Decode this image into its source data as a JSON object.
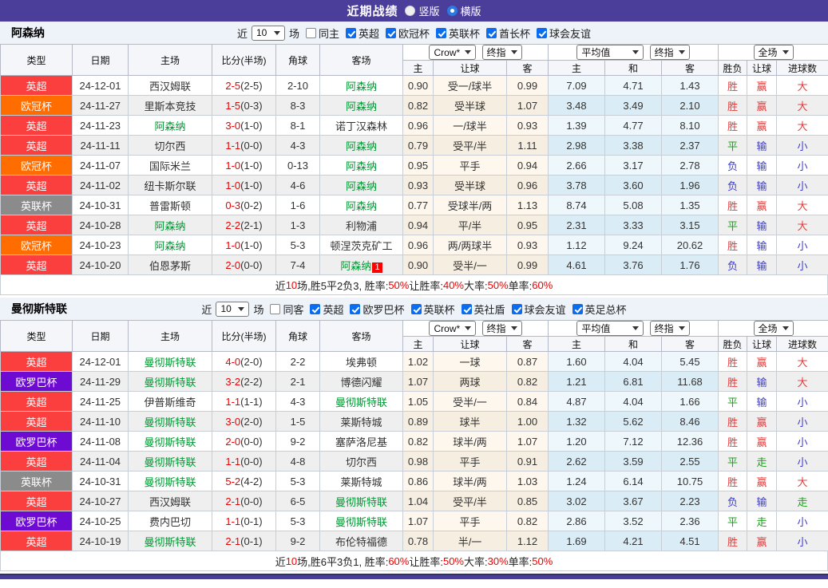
{
  "topbar": {
    "title": "近期战绩",
    "vertical_label": "竖版",
    "horizontal_label": "横版"
  },
  "columns": {
    "type": "类型",
    "date": "日期",
    "home": "主场",
    "score": "比分(半场)",
    "corner": "角球",
    "away": "客场",
    "odds_home": "主",
    "odds_handicap": "让球",
    "odds_away": "客",
    "avg_home": "主",
    "avg_draw": "和",
    "avg_away": "客",
    "result_outcome": "胜负",
    "result_handicap": "让球",
    "result_goals": "进球数",
    "select_company": "Crow*",
    "select_stage1": "终指",
    "select_average": "平均值",
    "select_stage2": "终指",
    "select_scope": "全场"
  },
  "filters_common": {
    "near": "近",
    "count": "10",
    "games": "场"
  },
  "league_colors": {
    "英超": "#fb3e3e",
    "欧冠杯": "#ff6c00",
    "英联杯": "#8b8b8b",
    "欧罗巴杯": "#6d0bd3"
  },
  "result_colors": {
    "r": "#e13c3c",
    "g": "#1ca01c",
    "b": "#3c3cc8"
  },
  "sections": [
    {
      "team": "阿森纳",
      "same_side": "同主",
      "leagues": [
        "英超",
        "欧冠杯",
        "英联杯",
        "酋长杯",
        "球会友谊"
      ],
      "rows": [
        {
          "league": "英超",
          "date": "24-12-01",
          "home": "西汉姆联",
          "home_focus": false,
          "score": "2-5",
          "half": "(2-5)",
          "corner": "2-10",
          "away": "阿森纳",
          "away_focus": true,
          "away_card": "",
          "odds": [
            "0.90",
            "受一/球半",
            "0.99"
          ],
          "avg": [
            "7.09",
            "4.71",
            "1.43"
          ],
          "results": [
            [
              "胜",
              "r"
            ],
            [
              "赢",
              "r"
            ],
            [
              "大",
              "r"
            ]
          ]
        },
        {
          "league": "欧冠杯",
          "date": "24-11-27",
          "home": "里斯本竞技",
          "home_focus": false,
          "score": "1-5",
          "half": "(0-3)",
          "corner": "8-3",
          "away": "阿森纳",
          "away_focus": true,
          "away_card": "",
          "odds": [
            "0.82",
            "受半球",
            "1.07"
          ],
          "avg": [
            "3.48",
            "3.49",
            "2.10"
          ],
          "results": [
            [
              "胜",
              "r"
            ],
            [
              "赢",
              "r"
            ],
            [
              "大",
              "r"
            ]
          ]
        },
        {
          "league": "英超",
          "date": "24-11-23",
          "home": "阿森纳",
          "home_focus": true,
          "score": "3-0",
          "half": "(1-0)",
          "corner": "8-1",
          "away": "诺丁汉森林",
          "away_focus": false,
          "away_card": "",
          "odds": [
            "0.96",
            "一/球半",
            "0.93"
          ],
          "avg": [
            "1.39",
            "4.77",
            "8.10"
          ],
          "results": [
            [
              "胜",
              "r"
            ],
            [
              "赢",
              "r"
            ],
            [
              "大",
              "r"
            ]
          ]
        },
        {
          "league": "英超",
          "date": "24-11-11",
          "home": "切尔西",
          "home_focus": false,
          "score": "1-1",
          "half": "(0-0)",
          "corner": "4-3",
          "away": "阿森纳",
          "away_focus": true,
          "away_card": "",
          "odds": [
            "0.79",
            "受平/半",
            "1.11"
          ],
          "avg": [
            "2.98",
            "3.38",
            "2.37"
          ],
          "results": [
            [
              "平",
              "g"
            ],
            [
              "输",
              "b"
            ],
            [
              "小",
              "b"
            ]
          ]
        },
        {
          "league": "欧冠杯",
          "date": "24-11-07",
          "home": "国际米兰",
          "home_focus": false,
          "score": "1-0",
          "half": "(1-0)",
          "corner": "0-13",
          "away": "阿森纳",
          "away_focus": true,
          "away_card": "",
          "odds": [
            "0.95",
            "平手",
            "0.94"
          ],
          "avg": [
            "2.66",
            "3.17",
            "2.78"
          ],
          "results": [
            [
              "负",
              "b"
            ],
            [
              "输",
              "b"
            ],
            [
              "小",
              "b"
            ]
          ]
        },
        {
          "league": "英超",
          "date": "24-11-02",
          "home": "纽卡斯尔联",
          "home_focus": false,
          "score": "1-0",
          "half": "(1-0)",
          "corner": "4-6",
          "away": "阿森纳",
          "away_focus": true,
          "away_card": "",
          "odds": [
            "0.93",
            "受半球",
            "0.96"
          ],
          "avg": [
            "3.78",
            "3.60",
            "1.96"
          ],
          "results": [
            [
              "负",
              "b"
            ],
            [
              "输",
              "b"
            ],
            [
              "小",
              "b"
            ]
          ]
        },
        {
          "league": "英联杯",
          "date": "24-10-31",
          "home": "普雷斯顿",
          "home_focus": false,
          "score": "0-3",
          "half": "(0-2)",
          "corner": "1-6",
          "away": "阿森纳",
          "away_focus": true,
          "away_card": "",
          "odds": [
            "0.77",
            "受球半/两",
            "1.13"
          ],
          "avg": [
            "8.74",
            "5.08",
            "1.35"
          ],
          "results": [
            [
              "胜",
              "r"
            ],
            [
              "赢",
              "r"
            ],
            [
              "大",
              "r"
            ]
          ]
        },
        {
          "league": "英超",
          "date": "24-10-28",
          "home": "阿森纳",
          "home_focus": true,
          "score": "2-2",
          "half": "(2-1)",
          "corner": "1-3",
          "away": "利物浦",
          "away_focus": false,
          "away_card": "",
          "odds": [
            "0.94",
            "平/半",
            "0.95"
          ],
          "avg": [
            "2.31",
            "3.33",
            "3.15"
          ],
          "results": [
            [
              "平",
              "g"
            ],
            [
              "输",
              "b"
            ],
            [
              "大",
              "r"
            ]
          ]
        },
        {
          "league": "欧冠杯",
          "date": "24-10-23",
          "home": "阿森纳",
          "home_focus": true,
          "score": "1-0",
          "half": "(1-0)",
          "corner": "5-3",
          "away": "顿涅茨克矿工",
          "away_focus": false,
          "away_card": "",
          "odds": [
            "0.96",
            "两/两球半",
            "0.93"
          ],
          "avg": [
            "1.12",
            "9.24",
            "20.62"
          ],
          "results": [
            [
              "胜",
              "r"
            ],
            [
              "输",
              "b"
            ],
            [
              "小",
              "b"
            ]
          ]
        },
        {
          "league": "英超",
          "date": "24-10-20",
          "home": "伯恩茅斯",
          "home_focus": false,
          "score": "2-0",
          "half": "(0-0)",
          "corner": "7-4",
          "away": "阿森纳",
          "away_focus": true,
          "away_card": "1",
          "odds": [
            "0.90",
            "受半/一",
            "0.99"
          ],
          "avg": [
            "4.61",
            "3.76",
            "1.76"
          ],
          "results": [
            [
              "负",
              "b"
            ],
            [
              "输",
              "b"
            ],
            [
              "小",
              "b"
            ]
          ]
        }
      ],
      "summary": [
        [
          "近",
          "k"
        ],
        [
          "10",
          "r"
        ],
        [
          "场,胜5平2负3, 胜率:",
          "k"
        ],
        [
          "50%",
          "r"
        ],
        [
          " 让胜率:",
          "k"
        ],
        [
          "40%",
          "r"
        ],
        [
          " 大率:",
          "k"
        ],
        [
          "50%",
          "r"
        ],
        [
          " 单率:",
          "k"
        ],
        [
          "60%",
          "r"
        ]
      ]
    },
    {
      "team": "曼彻斯特联",
      "same_side": "同客",
      "leagues": [
        "英超",
        "欧罗巴杯",
        "英联杯",
        "英社盾",
        "球会友谊",
        "英足总杯"
      ],
      "rows": [
        {
          "league": "英超",
          "date": "24-12-01",
          "home": "曼彻斯特联",
          "home_focus": true,
          "score": "4-0",
          "half": "(2-0)",
          "corner": "2-2",
          "away": "埃弗顿",
          "away_focus": false,
          "away_card": "",
          "odds": [
            "1.02",
            "一球",
            "0.87"
          ],
          "avg": [
            "1.60",
            "4.04",
            "5.45"
          ],
          "results": [
            [
              "胜",
              "r"
            ],
            [
              "赢",
              "r"
            ],
            [
              "大",
              "r"
            ]
          ]
        },
        {
          "league": "欧罗巴杯",
          "date": "24-11-29",
          "home": "曼彻斯特联",
          "home_focus": true,
          "score": "3-2",
          "half": "(2-2)",
          "corner": "2-1",
          "away": "博德闪耀",
          "away_focus": false,
          "away_card": "",
          "odds": [
            "1.07",
            "两球",
            "0.82"
          ],
          "avg": [
            "1.21",
            "6.81",
            "11.68"
          ],
          "results": [
            [
              "胜",
              "r"
            ],
            [
              "输",
              "b"
            ],
            [
              "大",
              "r"
            ]
          ]
        },
        {
          "league": "英超",
          "date": "24-11-25",
          "home": "伊普斯维奇",
          "home_focus": false,
          "score": "1-1",
          "half": "(1-1)",
          "corner": "4-3",
          "away": "曼彻斯特联",
          "away_focus": true,
          "away_card": "",
          "odds": [
            "1.05",
            "受半/一",
            "0.84"
          ],
          "avg": [
            "4.87",
            "4.04",
            "1.66"
          ],
          "results": [
            [
              "平",
              "g"
            ],
            [
              "输",
              "b"
            ],
            [
              "小",
              "b"
            ]
          ]
        },
        {
          "league": "英超",
          "date": "24-11-10",
          "home": "曼彻斯特联",
          "home_focus": true,
          "score": "3-0",
          "half": "(2-0)",
          "corner": "1-5",
          "away": "莱斯特城",
          "away_focus": false,
          "away_card": "",
          "odds": [
            "0.89",
            "球半",
            "1.00"
          ],
          "avg": [
            "1.32",
            "5.62",
            "8.46"
          ],
          "results": [
            [
              "胜",
              "r"
            ],
            [
              "赢",
              "r"
            ],
            [
              "小",
              "b"
            ]
          ]
        },
        {
          "league": "欧罗巴杯",
          "date": "24-11-08",
          "home": "曼彻斯特联",
          "home_focus": true,
          "score": "2-0",
          "half": "(0-0)",
          "corner": "9-2",
          "away": "塞萨洛尼基",
          "away_focus": false,
          "away_card": "",
          "odds": [
            "0.82",
            "球半/两",
            "1.07"
          ],
          "avg": [
            "1.20",
            "7.12",
            "12.36"
          ],
          "results": [
            [
              "胜",
              "r"
            ],
            [
              "赢",
              "r"
            ],
            [
              "小",
              "b"
            ]
          ]
        },
        {
          "league": "英超",
          "date": "24-11-04",
          "home": "曼彻斯特联",
          "home_focus": true,
          "score": "1-1",
          "half": "(0-0)",
          "corner": "4-8",
          "away": "切尔西",
          "away_focus": false,
          "away_card": "",
          "odds": [
            "0.98",
            "平手",
            "0.91"
          ],
          "avg": [
            "2.62",
            "3.59",
            "2.55"
          ],
          "results": [
            [
              "平",
              "g"
            ],
            [
              "走",
              "g"
            ],
            [
              "小",
              "b"
            ]
          ]
        },
        {
          "league": "英联杯",
          "date": "24-10-31",
          "home": "曼彻斯特联",
          "home_focus": true,
          "score": "5-2",
          "half": "(4-2)",
          "corner": "5-3",
          "away": "莱斯特城",
          "away_focus": false,
          "away_card": "",
          "odds": [
            "0.86",
            "球半/两",
            "1.03"
          ],
          "avg": [
            "1.24",
            "6.14",
            "10.75"
          ],
          "results": [
            [
              "胜",
              "r"
            ],
            [
              "赢",
              "r"
            ],
            [
              "大",
              "r"
            ]
          ]
        },
        {
          "league": "英超",
          "date": "24-10-27",
          "home": "西汉姆联",
          "home_focus": false,
          "score": "2-1",
          "half": "(0-0)",
          "corner": "6-5",
          "away": "曼彻斯特联",
          "away_focus": true,
          "away_card": "",
          "odds": [
            "1.04",
            "受平/半",
            "0.85"
          ],
          "avg": [
            "3.02",
            "3.67",
            "2.23"
          ],
          "results": [
            [
              "负",
              "b"
            ],
            [
              "输",
              "b"
            ],
            [
              "走",
              "g"
            ]
          ]
        },
        {
          "league": "欧罗巴杯",
          "date": "24-10-25",
          "home": "费内巴切",
          "home_focus": false,
          "score": "1-1",
          "half": "(0-1)",
          "corner": "5-3",
          "away": "曼彻斯特联",
          "away_focus": true,
          "away_card": "",
          "odds": [
            "1.07",
            "平手",
            "0.82"
          ],
          "avg": [
            "2.86",
            "3.52",
            "2.36"
          ],
          "results": [
            [
              "平",
              "g"
            ],
            [
              "走",
              "g"
            ],
            [
              "小",
              "b"
            ]
          ]
        },
        {
          "league": "英超",
          "date": "24-10-19",
          "home": "曼彻斯特联",
          "home_focus": true,
          "score": "2-1",
          "half": "(0-1)",
          "corner": "9-2",
          "away": "布伦特福德",
          "away_focus": false,
          "away_card": "",
          "odds": [
            "0.78",
            "半/一",
            "1.12"
          ],
          "avg": [
            "1.69",
            "4.21",
            "4.51"
          ],
          "results": [
            [
              "胜",
              "r"
            ],
            [
              "赢",
              "r"
            ],
            [
              "小",
              "b"
            ]
          ]
        }
      ],
      "summary": [
        [
          "近",
          "k"
        ],
        [
          "10",
          "r"
        ],
        [
          "场,胜6平3负1, 胜率:",
          "k"
        ],
        [
          "60%",
          "r"
        ],
        [
          " 让胜率:",
          "k"
        ],
        [
          "50%",
          "r"
        ],
        [
          " 大率:",
          "k"
        ],
        [
          "30%",
          "r"
        ],
        [
          " 单率:",
          "k"
        ],
        [
          "50%",
          "r"
        ]
      ]
    }
  ]
}
